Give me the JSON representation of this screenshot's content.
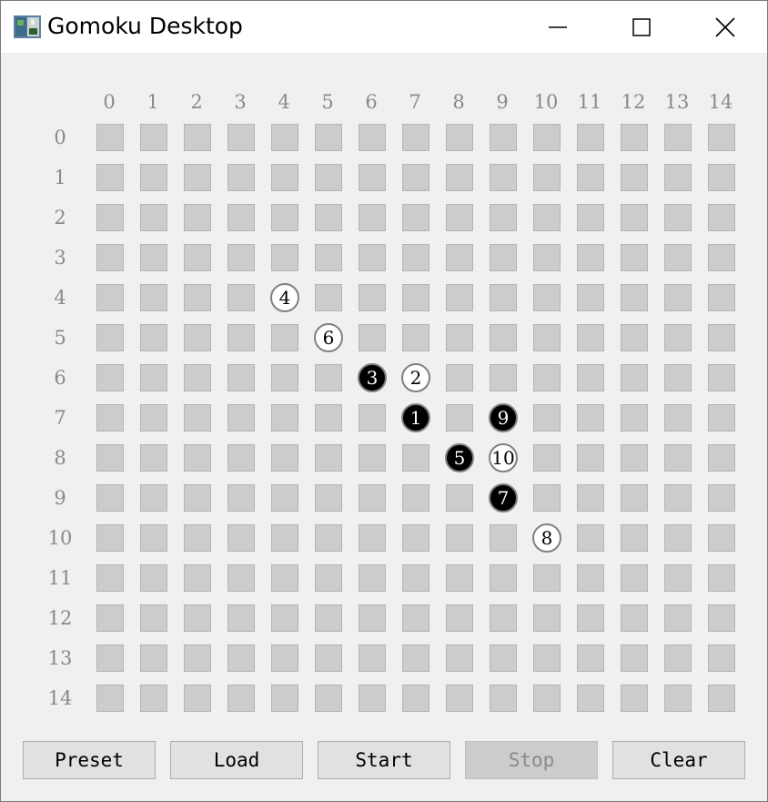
{
  "window": {
    "title": "Gomoku Desktop",
    "controls": {
      "minimize": "minimize-icon",
      "maximize": "maximize-icon",
      "close": "close-icon"
    }
  },
  "board": {
    "size": 15,
    "column_labels": [
      "0",
      "1",
      "2",
      "3",
      "4",
      "5",
      "6",
      "7",
      "8",
      "9",
      "10",
      "11",
      "12",
      "13",
      "14"
    ],
    "row_labels": [
      "0",
      "1",
      "2",
      "3",
      "4",
      "5",
      "6",
      "7",
      "8",
      "9",
      "10",
      "11",
      "12",
      "13",
      "14"
    ],
    "colors": {
      "cell": "#cccccc",
      "black_stone": "#000000",
      "white_stone": "#ffffff",
      "label": "#8a8a8a"
    },
    "stones": [
      {
        "move": "1",
        "color": "black",
        "row": 7,
        "col": 7
      },
      {
        "move": "2",
        "color": "white",
        "row": 6,
        "col": 7
      },
      {
        "move": "3",
        "color": "black",
        "row": 6,
        "col": 6
      },
      {
        "move": "4",
        "color": "white",
        "row": 4,
        "col": 4
      },
      {
        "move": "5",
        "color": "black",
        "row": 8,
        "col": 8
      },
      {
        "move": "6",
        "color": "white",
        "row": 5,
        "col": 5
      },
      {
        "move": "7",
        "color": "black",
        "row": 9,
        "col": 9
      },
      {
        "move": "8",
        "color": "white",
        "row": 10,
        "col": 10
      },
      {
        "move": "9",
        "color": "black",
        "row": 7,
        "col": 9
      },
      {
        "move": "10",
        "color": "white",
        "row": 8,
        "col": 9
      }
    ]
  },
  "buttons": [
    {
      "label": "Preset",
      "enabled": true
    },
    {
      "label": "Load",
      "enabled": true
    },
    {
      "label": "Start",
      "enabled": true
    },
    {
      "label": "Stop",
      "enabled": false
    },
    {
      "label": "Clear",
      "enabled": true
    }
  ]
}
